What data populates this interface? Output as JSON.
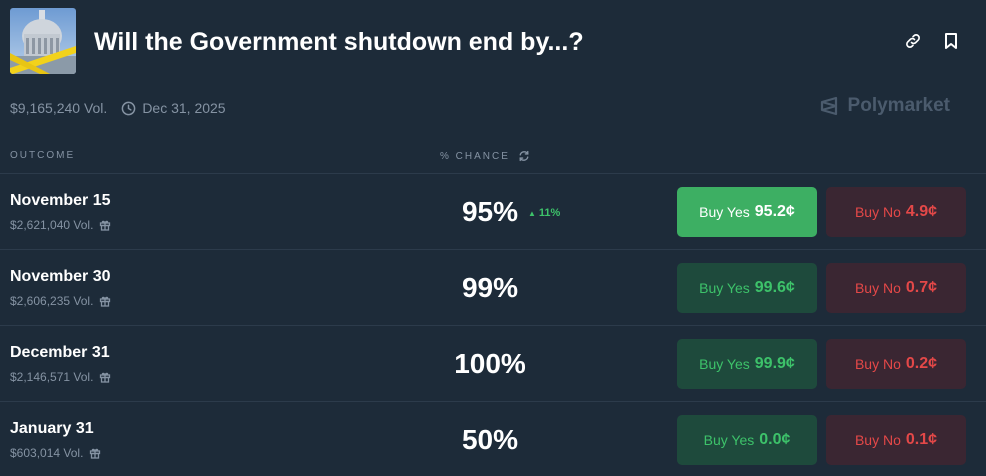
{
  "market": {
    "title": "Will the Government shutdown end by...?",
    "volume": "$9,165,240 Vol.",
    "end_date": "Dec 31, 2025",
    "brand": "Polymarket"
  },
  "columns": {
    "outcome": "OUTCOME",
    "chance": "% CHANCE"
  },
  "outcomes": [
    {
      "name": "November 15",
      "volume": "$2,621,040 Vol.",
      "chance": "95%",
      "delta": "11%",
      "yes_label": "Buy Yes",
      "yes_price": "95.2¢",
      "no_label": "Buy No",
      "no_price": "4.9¢"
    },
    {
      "name": "November 30",
      "volume": "$2,606,235 Vol.",
      "chance": "99%",
      "yes_label": "Buy Yes",
      "yes_price": "99.6¢",
      "no_label": "Buy No",
      "no_price": "0.7¢"
    },
    {
      "name": "December 31",
      "volume": "$2,146,571 Vol.",
      "chance": "100%",
      "yes_label": "Buy Yes",
      "yes_price": "99.9¢",
      "no_label": "Buy No",
      "no_price": "0.2¢"
    },
    {
      "name": "January 31",
      "volume": "$603,014 Vol.",
      "chance": "50%",
      "yes_label": "Buy Yes",
      "yes_price": "0.0¢",
      "no_label": "Buy No",
      "no_price": "0.1¢"
    }
  ],
  "icons": {
    "link": "link-icon",
    "bookmark": "bookmark-icon",
    "clock": "clock-icon",
    "refresh": "refresh-icon",
    "gift": "gift-icon",
    "brand_logo": "polymarket-logo-icon"
  },
  "colors": {
    "background": "#1d2b39",
    "yes_green": "#3dc26a",
    "yes_active_bg": "#3daf63",
    "no_red": "#e44848"
  }
}
